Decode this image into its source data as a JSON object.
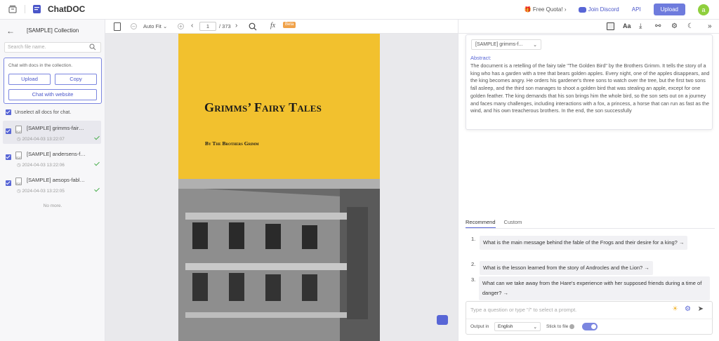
{
  "app": {
    "name": "ChatDOC"
  },
  "topbar": {
    "quota": "Free Quota!",
    "discord": "Join Discord",
    "api": "API",
    "upload": "Upload",
    "avatar_letter": "a"
  },
  "sidebar": {
    "title": "[SAMPLE] Collection",
    "search_placeholder": "Search file name.",
    "chat_hint": "Chat with docs in the collection.",
    "upload_btn": "Upload",
    "copy_btn": "Copy",
    "website_btn": "Chat with website",
    "unselect": "Unselect all docs for chat.",
    "docs": [
      {
        "name": "[SAMPLE] grimms-fair…",
        "date": "2024-04-03 13:22:07"
      },
      {
        "name": "[SAMPLE] andersens-f…",
        "date": "2024-04-03 13:22:06"
      },
      {
        "name": "[SAMPLE] aesops-fabl…",
        "date": "2024-04-03 13:22:05"
      }
    ],
    "no_more": "No more."
  },
  "viewer": {
    "zoom": "Auto Fit",
    "page": "1",
    "total": "/ 373",
    "beta": "Beta",
    "book_title": "Grimms’ Fairy Tales",
    "book_author": "By The Brothers Grimm"
  },
  "panel": {
    "doc_select": "[SAMPLE] grimms-f...",
    "abstract_label": "Abstract:",
    "abstract": "The document is a retelling of the fairy tale \"The Golden Bird\" by the Brothers Grimm. It tells the story of a king who has a garden with a tree that bears golden apples. Every night, one of the apples disappears, and the king becomes angry. He orders his gardener's three sons to watch over the tree, but the first two sons fall asleep, and the third son manages to shoot a golden bird that was stealing an apple, except for one golden feather. The king demands that his son brings him the whole bird, so the son sets out on a journey and faces many challenges, including interactions with a fox, a princess, a horse that can run as fast as the wind, and his own treacherous brothers. In the end, the son successfully",
    "tab_recommend": "Recommend",
    "tab_custom": "Custom",
    "questions": [
      {
        "num": "1.",
        "text": "What is the main message behind the fable of the Frogs and their desire for a king? →"
      },
      {
        "num": "2.",
        "text": "What is the lesson learned from the story of Androcles and the Lion? →"
      },
      {
        "num": "3.",
        "text": "What can we take away from the Hare's experience with her supposed friends during a time of danger? →"
      }
    ],
    "input_placeholder": "Type a question or type \"/\" to select a prompt.",
    "output_label": "Output in",
    "language": "English",
    "stick_label": "Stick to file"
  },
  "colors": {
    "accent": "#5866d6",
    "cover": "#f2c12e"
  }
}
